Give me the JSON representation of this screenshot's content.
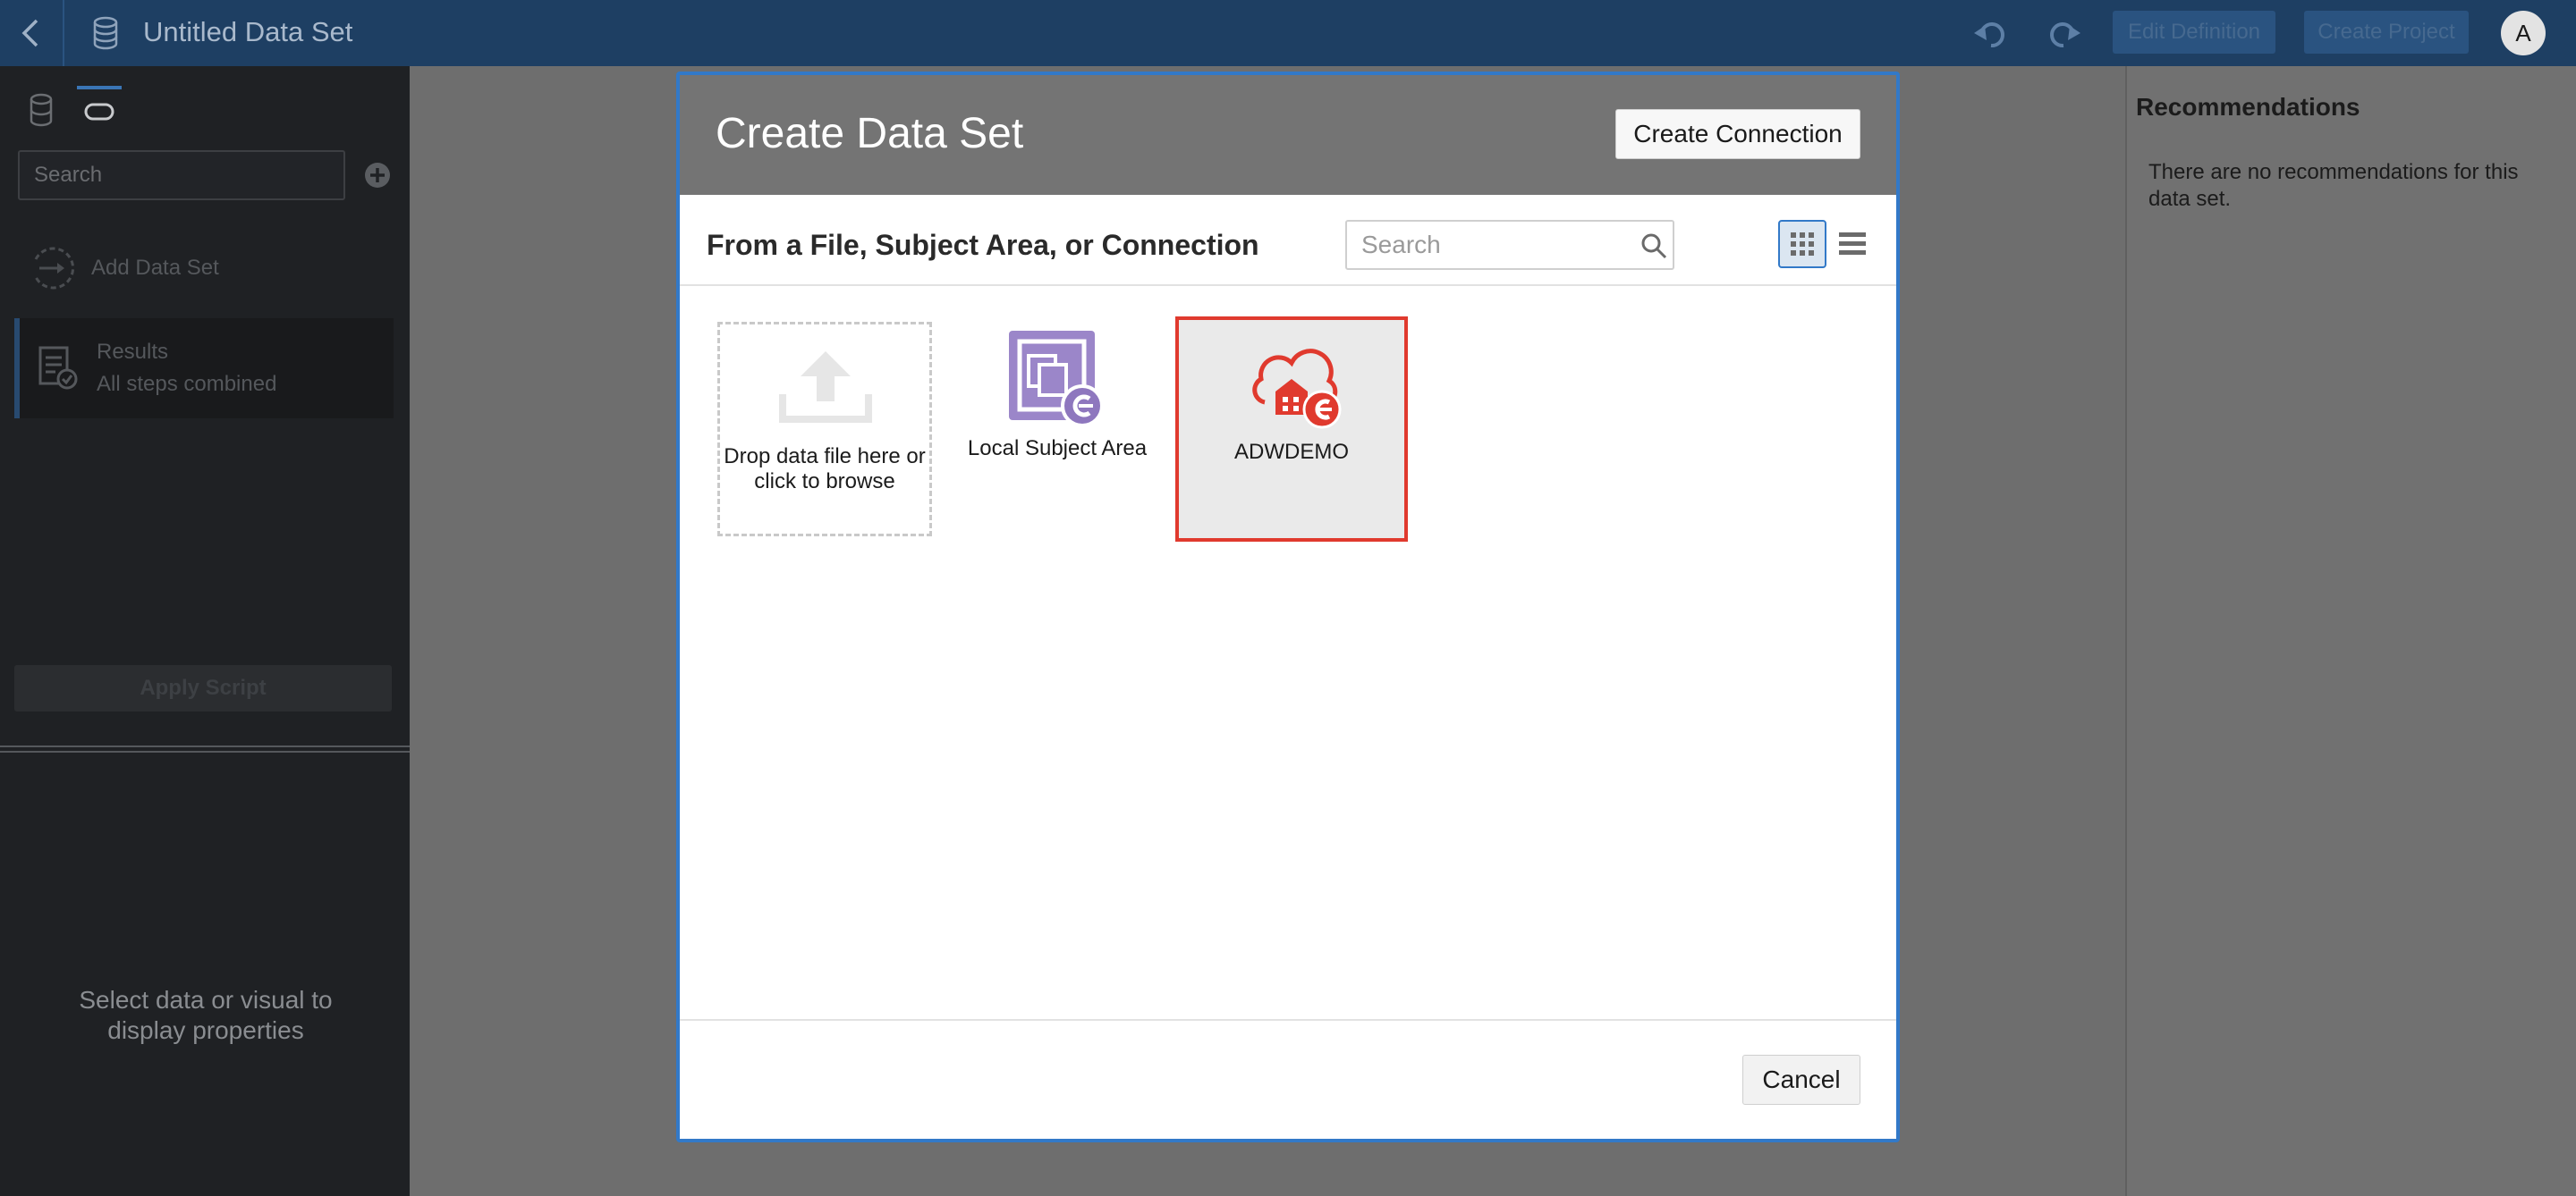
{
  "header": {
    "title": "Untitled Data Set",
    "edit_definition_label": "Edit Definition",
    "create_project_label": "Create Project",
    "avatar_initial": "A"
  },
  "left_panel": {
    "search_placeholder": "Search",
    "add_data_set_label": "Add Data Set",
    "results_title": "Results",
    "results_subtitle": "All steps combined",
    "apply_script_label": "Apply Script",
    "properties_message": "Select data or visual to display properties"
  },
  "right_panel": {
    "title": "Recommendations",
    "message": "There are no recommendations for this data set."
  },
  "modal": {
    "title": "Create Data Set",
    "create_connection_label": "Create Connection",
    "section_heading": "From a File, Subject Area, or Connection",
    "search_placeholder": "Search",
    "tiles": {
      "drop_file": "Drop data file here or click to browse",
      "local_subject_area": "Local Subject Area",
      "connection": "ADWDEMO"
    },
    "cancel_label": "Cancel"
  },
  "colors": {
    "topbar": "#1e3f63",
    "accent_blue": "#3279c8",
    "selection_red": "#e03a2e",
    "subject_area_purple": "#9b86c9"
  }
}
